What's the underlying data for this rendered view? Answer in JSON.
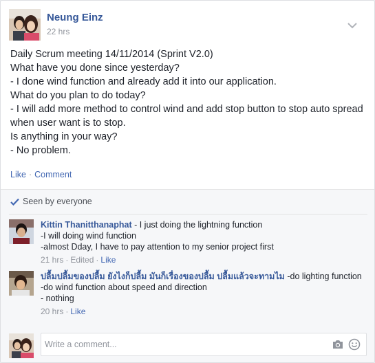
{
  "post": {
    "author": "Neung Einz",
    "time": "22 hrs",
    "lines": [
      "Daily Scrum meeting 14/11/2014 (Sprint V2.0)",
      "What have you done since yesterday?",
      "- I done wind function and already add it into our application.",
      "What do you plan to do today?",
      "- I will add more method to control wind and add stop button to stop auto spread when user want is to stop.",
      "Is anything in your way?",
      "- No problem."
    ],
    "actions": {
      "like": "Like",
      "separator": "·",
      "comment": "Comment"
    },
    "menu_icon": "chevron-down-icon"
  },
  "feedback": {
    "seen_text": "Seen by everyone",
    "seen_icon": "checkmark-icon",
    "comments": [
      {
        "author": "Kittin Thanitthanaphat",
        "lines": [
          " - I just doing the lightning function",
          "-I will doing wind function",
          "-almost Dday, I have to pay attention to my senior project first"
        ],
        "time": "21 hrs",
        "edited": "Edited",
        "like": "Like",
        "separator": "·"
      },
      {
        "author": "ปลื้มปลื้มของปลื้ม ยังไงก็ปลื้ม มันก็เรื่องของปลื้ม ปลื้มแล้วจะทามไม",
        "lines": [
          " -do lighting function",
          "-do wind function about speed and direction",
          "- nothing"
        ],
        "time": "20 hrs",
        "like": "Like",
        "separator": "·"
      }
    ],
    "composer": {
      "placeholder": "Write a comment...",
      "camera_icon": "camera-icon",
      "emoji_icon": "smiley-icon"
    }
  },
  "colors": {
    "link": "#365899",
    "action": "#4267b2",
    "muted": "#90949c",
    "feedback_bg": "#f6f7f9"
  }
}
